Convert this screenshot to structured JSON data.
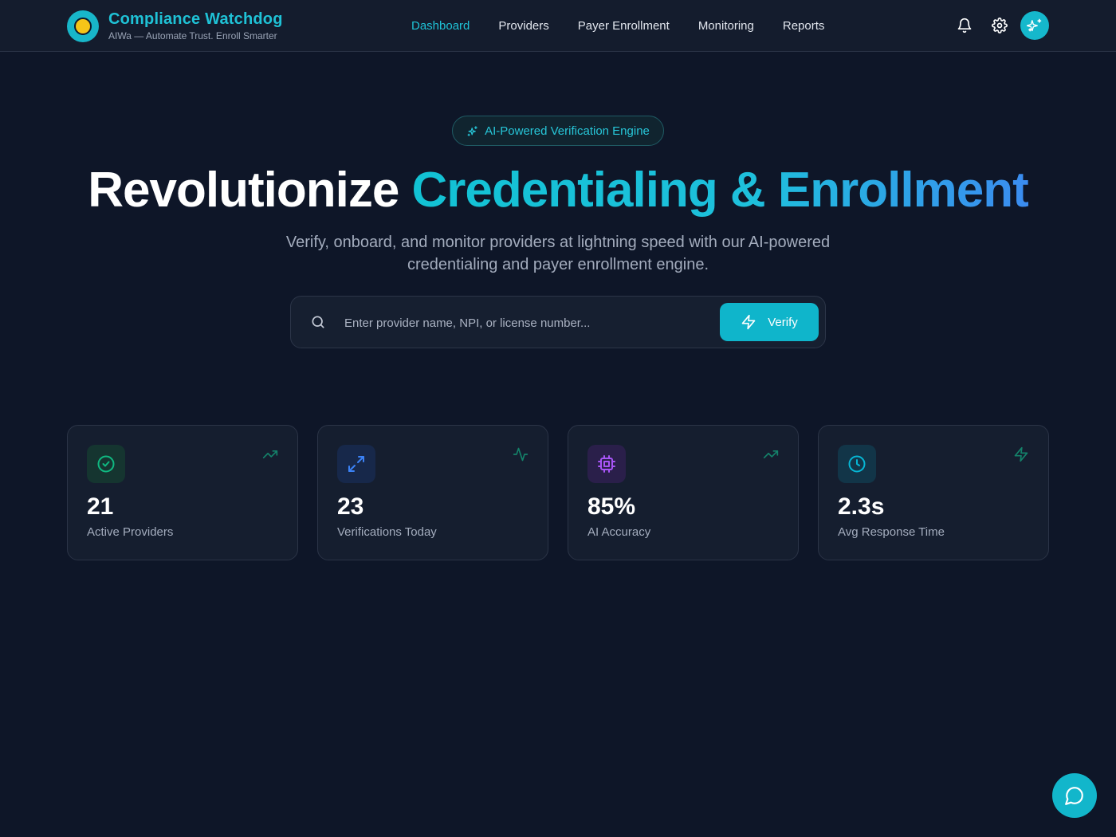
{
  "brand": {
    "title": "Compliance Watchdog",
    "subtitle": "AIWa — Automate Trust. Enroll Smarter"
  },
  "nav": {
    "items": [
      {
        "label": "Dashboard",
        "active": true
      },
      {
        "label": "Providers",
        "active": false
      },
      {
        "label": "Payer Enrollment",
        "active": false
      },
      {
        "label": "Monitoring",
        "active": false
      },
      {
        "label": "Reports",
        "active": false
      }
    ]
  },
  "header_actions": [
    "bell-icon",
    "gear-icon",
    "sparkles-icon"
  ],
  "hero": {
    "badge": "AI-Powered Verification Engine",
    "title_plain": "Revolutionize ",
    "title_highlight": "Credentialing & Enrollment",
    "subtitle": "Verify, onboard, and monitor providers at lightning speed with our AI-powered credentialing and payer enrollment engine."
  },
  "search": {
    "placeholder": "Enter provider name, NPI, or license number...",
    "value": "",
    "button_label": "Verify"
  },
  "stats": [
    {
      "value": "21",
      "label": "Active Providers",
      "icon": "check-circle-icon",
      "trend_icon": "trending-up-icon",
      "accent": "#10b981"
    },
    {
      "value": "23",
      "label": "Verifications Today",
      "icon": "arrows-expand-icon",
      "trend_icon": "activity-icon",
      "accent": "#3b82f6"
    },
    {
      "value": "85%",
      "label": "AI Accuracy",
      "icon": "cpu-icon",
      "trend_icon": "trending-up-icon",
      "accent": "#a855f7"
    },
    {
      "value": "2.3s",
      "label": "Avg Response Time",
      "icon": "clock-icon",
      "trend_icon": "zap-icon",
      "accent": "#06b6d4"
    }
  ],
  "colors": {
    "background": "#0e1628",
    "accent": "#12b6cb",
    "brand": "#1fc2d6"
  }
}
